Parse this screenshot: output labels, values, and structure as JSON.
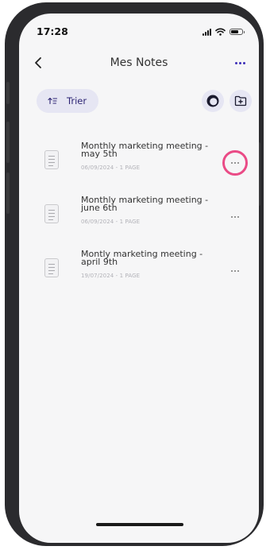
{
  "status_bar": {
    "time": "17:28"
  },
  "header": {
    "title": "Mes Notes"
  },
  "toolbar": {
    "sort_label": "Trier"
  },
  "notes": [
    {
      "title": "Monthly marketing meeting - may 5th",
      "meta": "06/09/2024 - 1 PAGE"
    },
    {
      "title": "Monthly marketing meeting - june 6th",
      "meta": "06/09/2024 - 1 PAGE"
    },
    {
      "title": "Montly marketing meeting - april 9th",
      "meta": "19/07/2024 - 1 PAGE"
    }
  ],
  "icons": {
    "back": "chevron-left-icon",
    "more": "more-horizontal-icon",
    "sort": "sort-icon",
    "record": "record-icon",
    "add_note": "folder-plus-icon",
    "note": "document-icon"
  },
  "colors": {
    "accent": "#3d2fb8",
    "pill_background": "#e6e6f3",
    "highlight": "#ea4b86"
  }
}
